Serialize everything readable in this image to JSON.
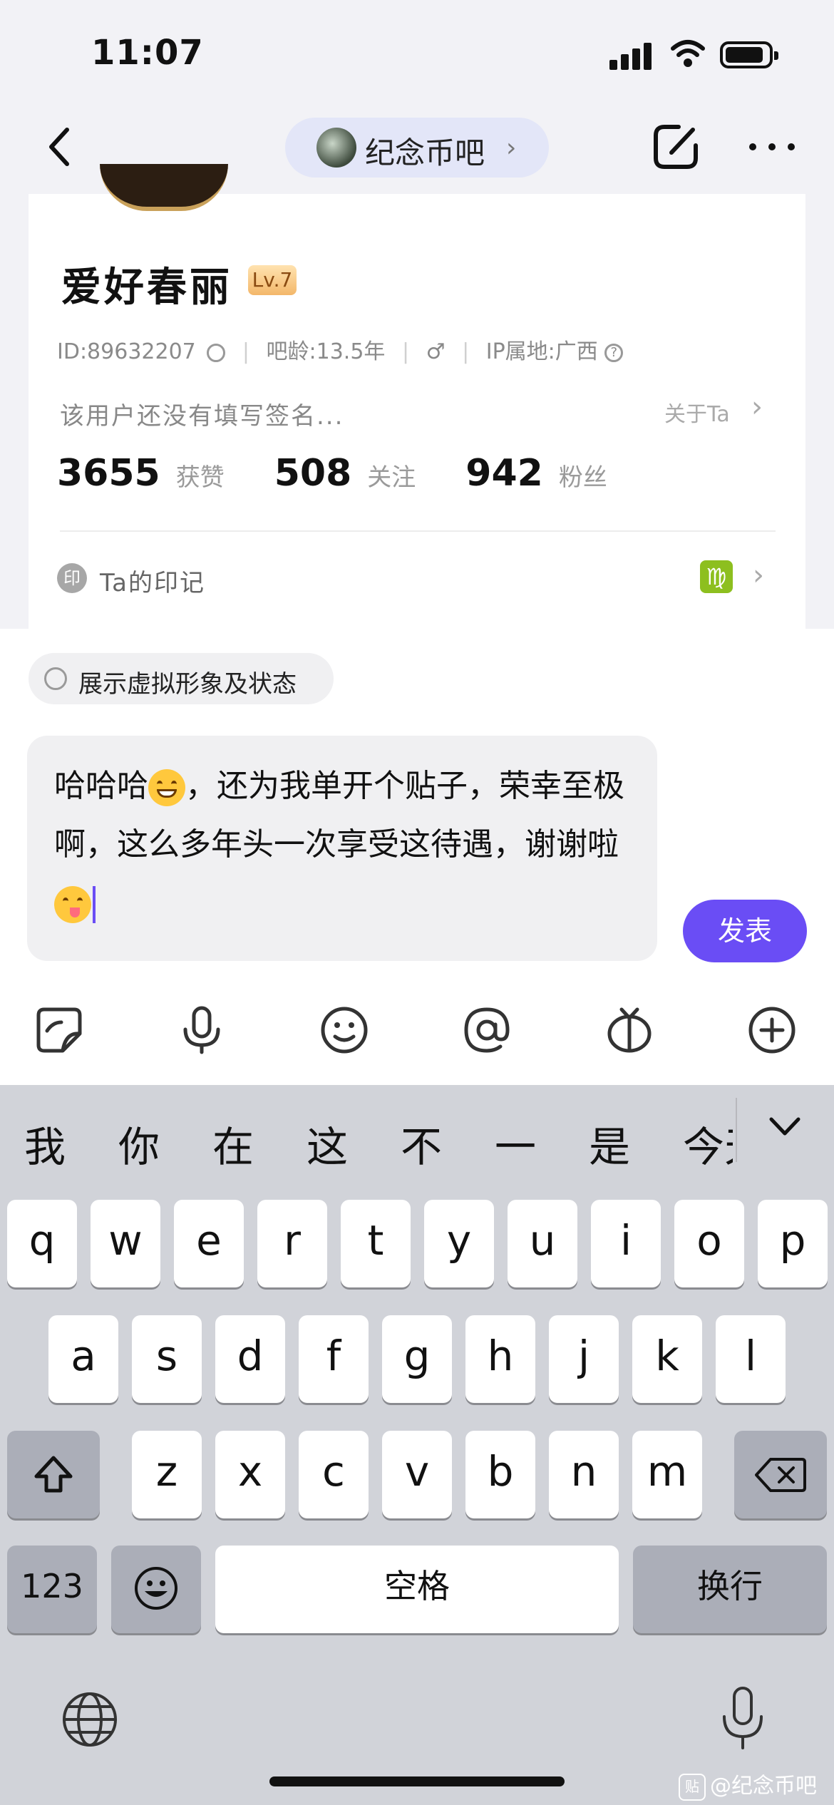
{
  "status_bar": {
    "time": "11:07"
  },
  "nav": {
    "forum_name": "纪念币吧",
    "forum_chevron": "›"
  },
  "profile": {
    "username": "爱好春丽",
    "level": "Lv.7",
    "id": "ID:89632207",
    "bar_age": "吧龄:13.5年",
    "ip_location": "IP属地:广西",
    "signature": "该用户还没有填写签名...",
    "about_link": "关于Ta",
    "stats": [
      {
        "value": "3655",
        "label": "获赞"
      },
      {
        "value": "508",
        "label": "关注"
      },
      {
        "value": "942",
        "label": "粉丝"
      }
    ],
    "stamp_icon_text": "印",
    "stamp_label": "Ta的印记",
    "zodiac_symbol": "♍"
  },
  "composer": {
    "avatar_toggle_label": "展示虚拟形象及状态",
    "text_part1": "哈哈哈",
    "text_part2": "，还为我单开个贴子，荣幸至极啊，这么多年头一次享受这待遇，谢谢啦",
    "publish_label": "发表",
    "toolbar_icons": [
      "sticker-icon",
      "microphone-icon",
      "emoji-icon",
      "at-icon",
      "gift-icon",
      "add-icon"
    ]
  },
  "keyboard": {
    "suggestions": [
      "我",
      "你",
      "在",
      "这",
      "不",
      "一",
      "是",
      "今天"
    ],
    "row1": [
      "q",
      "w",
      "e",
      "r",
      "t",
      "y",
      "u",
      "i",
      "o",
      "p"
    ],
    "row2": [
      "a",
      "s",
      "d",
      "f",
      "g",
      "h",
      "j",
      "k",
      "l"
    ],
    "row3": [
      "z",
      "x",
      "c",
      "v",
      "b",
      "n",
      "m"
    ],
    "numbers_label": "123",
    "space_label": "空格",
    "return_label": "换行"
  },
  "watermark": {
    "badge": "贴",
    "text": "@纪念币吧"
  },
  "colors": {
    "accent": "#6a4df5",
    "keyboard_bg": "#d1d3d9"
  }
}
